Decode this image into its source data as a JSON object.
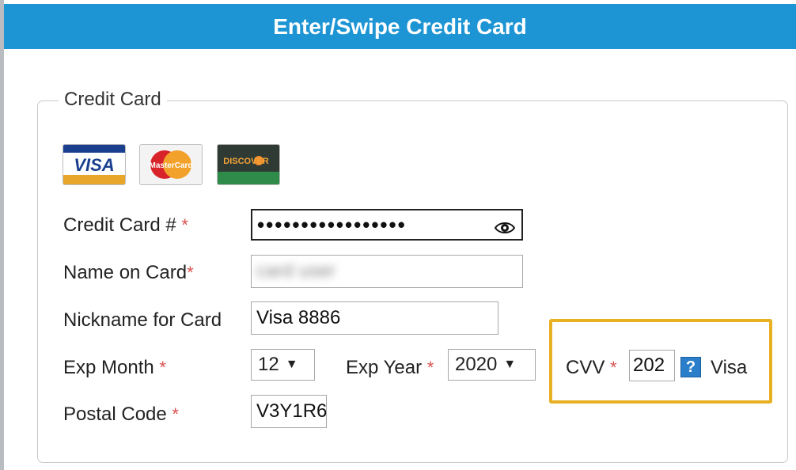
{
  "header": {
    "title": "Enter/Swipe Credit Card"
  },
  "section": {
    "legend": "Credit Card"
  },
  "card_logos": {
    "visa": "VISA",
    "mastercard": "MasterCard",
    "discover": "DISCOVER"
  },
  "fields": {
    "credit_card_number": {
      "label": "Credit Card #",
      "value": "•••••••••••••••••"
    },
    "name_on_card": {
      "label": "Name on Card",
      "value": "card user"
    },
    "nickname": {
      "label": "Nickname for Card",
      "value": "Visa 8886"
    },
    "exp_month": {
      "label": "Exp Month",
      "value": "12"
    },
    "exp_year": {
      "label": "Exp Year",
      "value": "2020"
    },
    "cvv": {
      "label": "CVV",
      "value": "202",
      "help": "?",
      "card_type": "Visa"
    },
    "postal_code": {
      "label": "Postal Code",
      "value": "V3Y1R6"
    }
  },
  "required_marker": "*",
  "colors": {
    "header_bg": "#1d95d4",
    "highlight": "#e8b023",
    "required": "#d9534f"
  }
}
